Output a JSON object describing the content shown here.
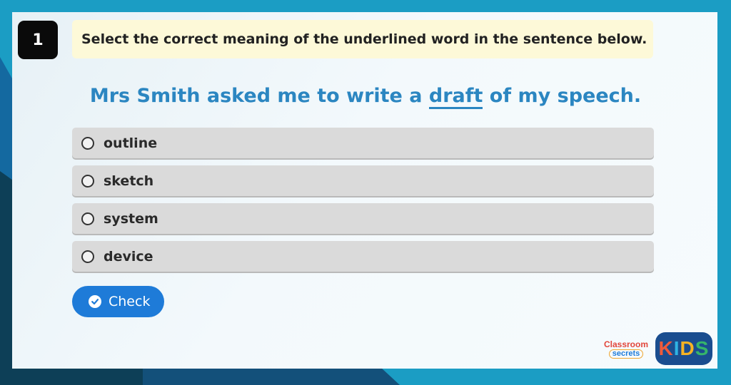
{
  "question": {
    "number": "1",
    "instruction": "Select the correct meaning of the underlined word in the sentence below.",
    "sentence_before": "Mrs Smith asked me to write a ",
    "sentence_underlined": "draft",
    "sentence_after": " of my speech."
  },
  "options": [
    {
      "label": "outline"
    },
    {
      "label": "sketch"
    },
    {
      "label": "system"
    },
    {
      "label": "device"
    }
  ],
  "check_button": {
    "label": "Check",
    "icon": "check-circle-icon"
  },
  "brand": {
    "line1": "Classroom",
    "line2": "secrets",
    "kids": [
      "K",
      "I",
      "D",
      "S"
    ]
  },
  "colors": {
    "accent_blue": "#1e7bd8",
    "sentence_blue": "#2b86c1",
    "instruction_bg": "#fdf9d8",
    "page_bg": "#1b9dc4"
  }
}
